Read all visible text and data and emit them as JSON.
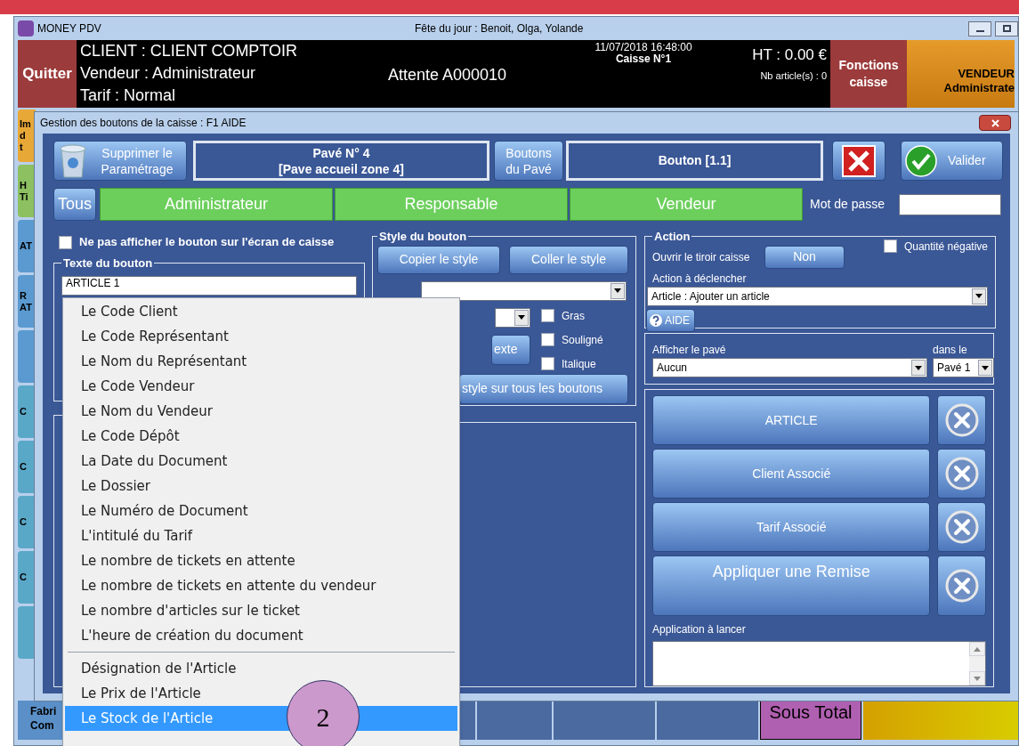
{
  "app": {
    "title": "MONEY PDV",
    "day_feast": "Fête du jour  : Benoit, Olga, Yolande",
    "quit": "Quitter",
    "client": "CLIENT : CLIENT COMPTOIR",
    "seller": "Vendeur : Administrateur",
    "tariff": "Tarif : Normal",
    "waiting": "Attente A000010",
    "datetime": "11/07/2018 16:48:00",
    "register": "Caisse N°1",
    "ht": "HT : 0.00 €",
    "items_count": "Nb article(s) : 0",
    "functions": "Fonctions caisse",
    "vendor_role": "VENDEUR",
    "vendor_name": "Administrate",
    "side_tiles": [
      {
        "lines": [
          "Im",
          "d",
          "t"
        ],
        "color": "#e8a838"
      },
      {
        "lines": [
          "H",
          "Ti"
        ],
        "color": "#8cc060"
      },
      {
        "lines": [
          "AT"
        ],
        "color": "#5a9ad0"
      },
      {
        "lines": [
          "R",
          "AT"
        ],
        "color": "#5a9ad0"
      },
      {
        "color": "#5a9ad0"
      },
      {
        "lines": [
          "C"
        ],
        "color": "#5aa8c8"
      },
      {
        "lines": [
          "C"
        ],
        "color": "#5aa8c8"
      },
      {
        "lines": [
          "C"
        ],
        "color": "#5aa8c8"
      },
      {
        "lines": [
          "C"
        ],
        "color": "#5aa8c8"
      },
      {
        "color": "#5aa8c8"
      }
    ],
    "bottom_tile": [
      "Fabri",
      "Com"
    ],
    "subtotal": "Sous Total"
  },
  "dialog": {
    "title": "Gestion des boutons de la caisse : F1 AIDE",
    "delete_button": [
      "Supprimer le",
      "Paramétrage"
    ],
    "pad": [
      "Pavé N° 4",
      "[Pave accueil zone 4]"
    ],
    "pad_buttons": [
      "Boutons",
      "du Pavé"
    ],
    "button_id": "Bouton [1.1]",
    "validate": "Valider",
    "profile_tabs": [
      {
        "label": "Tous",
        "selected": false
      },
      {
        "label": "Administrateur",
        "selected": true
      },
      {
        "label": "Responsable",
        "selected": true
      },
      {
        "label": "Vendeur",
        "selected": true
      }
    ],
    "password_label": "Mot de passe",
    "hide_checkbox": {
      "label": "Ne pas afficher le bouton sur l'écran de caisse",
      "checked": false
    },
    "text_group": {
      "legend": "Texte du bouton",
      "value": "ARTICLE 1"
    },
    "style_group": {
      "legend": "Style du bouton",
      "copy": "Copier le style",
      "paste": "Coller le style",
      "text_button": "exte",
      "apply_all": "style sur tous les boutons",
      "options": [
        {
          "label": "Gras",
          "checked": false
        },
        {
          "label": "Souligné",
          "checked": false
        },
        {
          "label": "Italique",
          "checked": false
        }
      ]
    },
    "action_group": {
      "legend": "Action",
      "drawer_label": "Ouvrir le tiroir caisse",
      "drawer_value": "Non",
      "negative_qty": {
        "label": "Quantité négative",
        "checked": false
      },
      "trigger_label": "Action à déclencher",
      "trigger_value": "Article : Ajouter un article",
      "help": "AIDE"
    },
    "pad_display": {
      "label": "Afficher le pavé",
      "value": "Aucun",
      "target_label": "dans le",
      "target_value": "Pavé 1"
    },
    "linked_buttons": [
      {
        "label": "ARTICLE",
        "kind": "normal"
      },
      {
        "label": "Client Associé",
        "kind": "normal"
      },
      {
        "label": "Tarif Associé",
        "kind": "normal"
      },
      {
        "label": "Appliquer une Remise",
        "kind": "large"
      }
    ],
    "app_label": "Application à lancer"
  },
  "menu": {
    "items": [
      {
        "kind": "item",
        "label": "Le Code Client",
        "selected": false
      },
      {
        "kind": "item",
        "label": "Le Code Représentant",
        "selected": false
      },
      {
        "kind": "item",
        "label": "Le Nom du Représentant",
        "selected": false
      },
      {
        "kind": "item",
        "label": "Le Code Vendeur",
        "selected": false
      },
      {
        "kind": "item",
        "label": "Le Nom du Vendeur",
        "selected": false
      },
      {
        "kind": "item",
        "label": "Le Code Dépôt",
        "selected": false
      },
      {
        "kind": "item",
        "label": "La Date du Document",
        "selected": false
      },
      {
        "kind": "item",
        "label": "Le Dossier",
        "selected": false
      },
      {
        "kind": "item",
        "label": "Le Numéro de Document",
        "selected": false
      },
      {
        "kind": "item",
        "label": "L'intitulé du Tarif",
        "selected": false
      },
      {
        "kind": "item",
        "label": "Le nombre de tickets en attente",
        "selected": false
      },
      {
        "kind": "item",
        "label": "Le nombre de tickets en attente du vendeur",
        "selected": false
      },
      {
        "kind": "item",
        "label": "Le nombre d'articles sur le ticket",
        "selected": false
      },
      {
        "kind": "item",
        "label": "L'heure de création du document",
        "selected": false
      },
      {
        "kind": "separator"
      },
      {
        "kind": "item",
        "label": "Désignation de l'Article",
        "selected": false
      },
      {
        "kind": "item",
        "label": "Le Prix de l'Article",
        "selected": false
      },
      {
        "kind": "item",
        "label": "Le Stock de l'Article",
        "selected": true
      }
    ]
  },
  "annotation": "2"
}
